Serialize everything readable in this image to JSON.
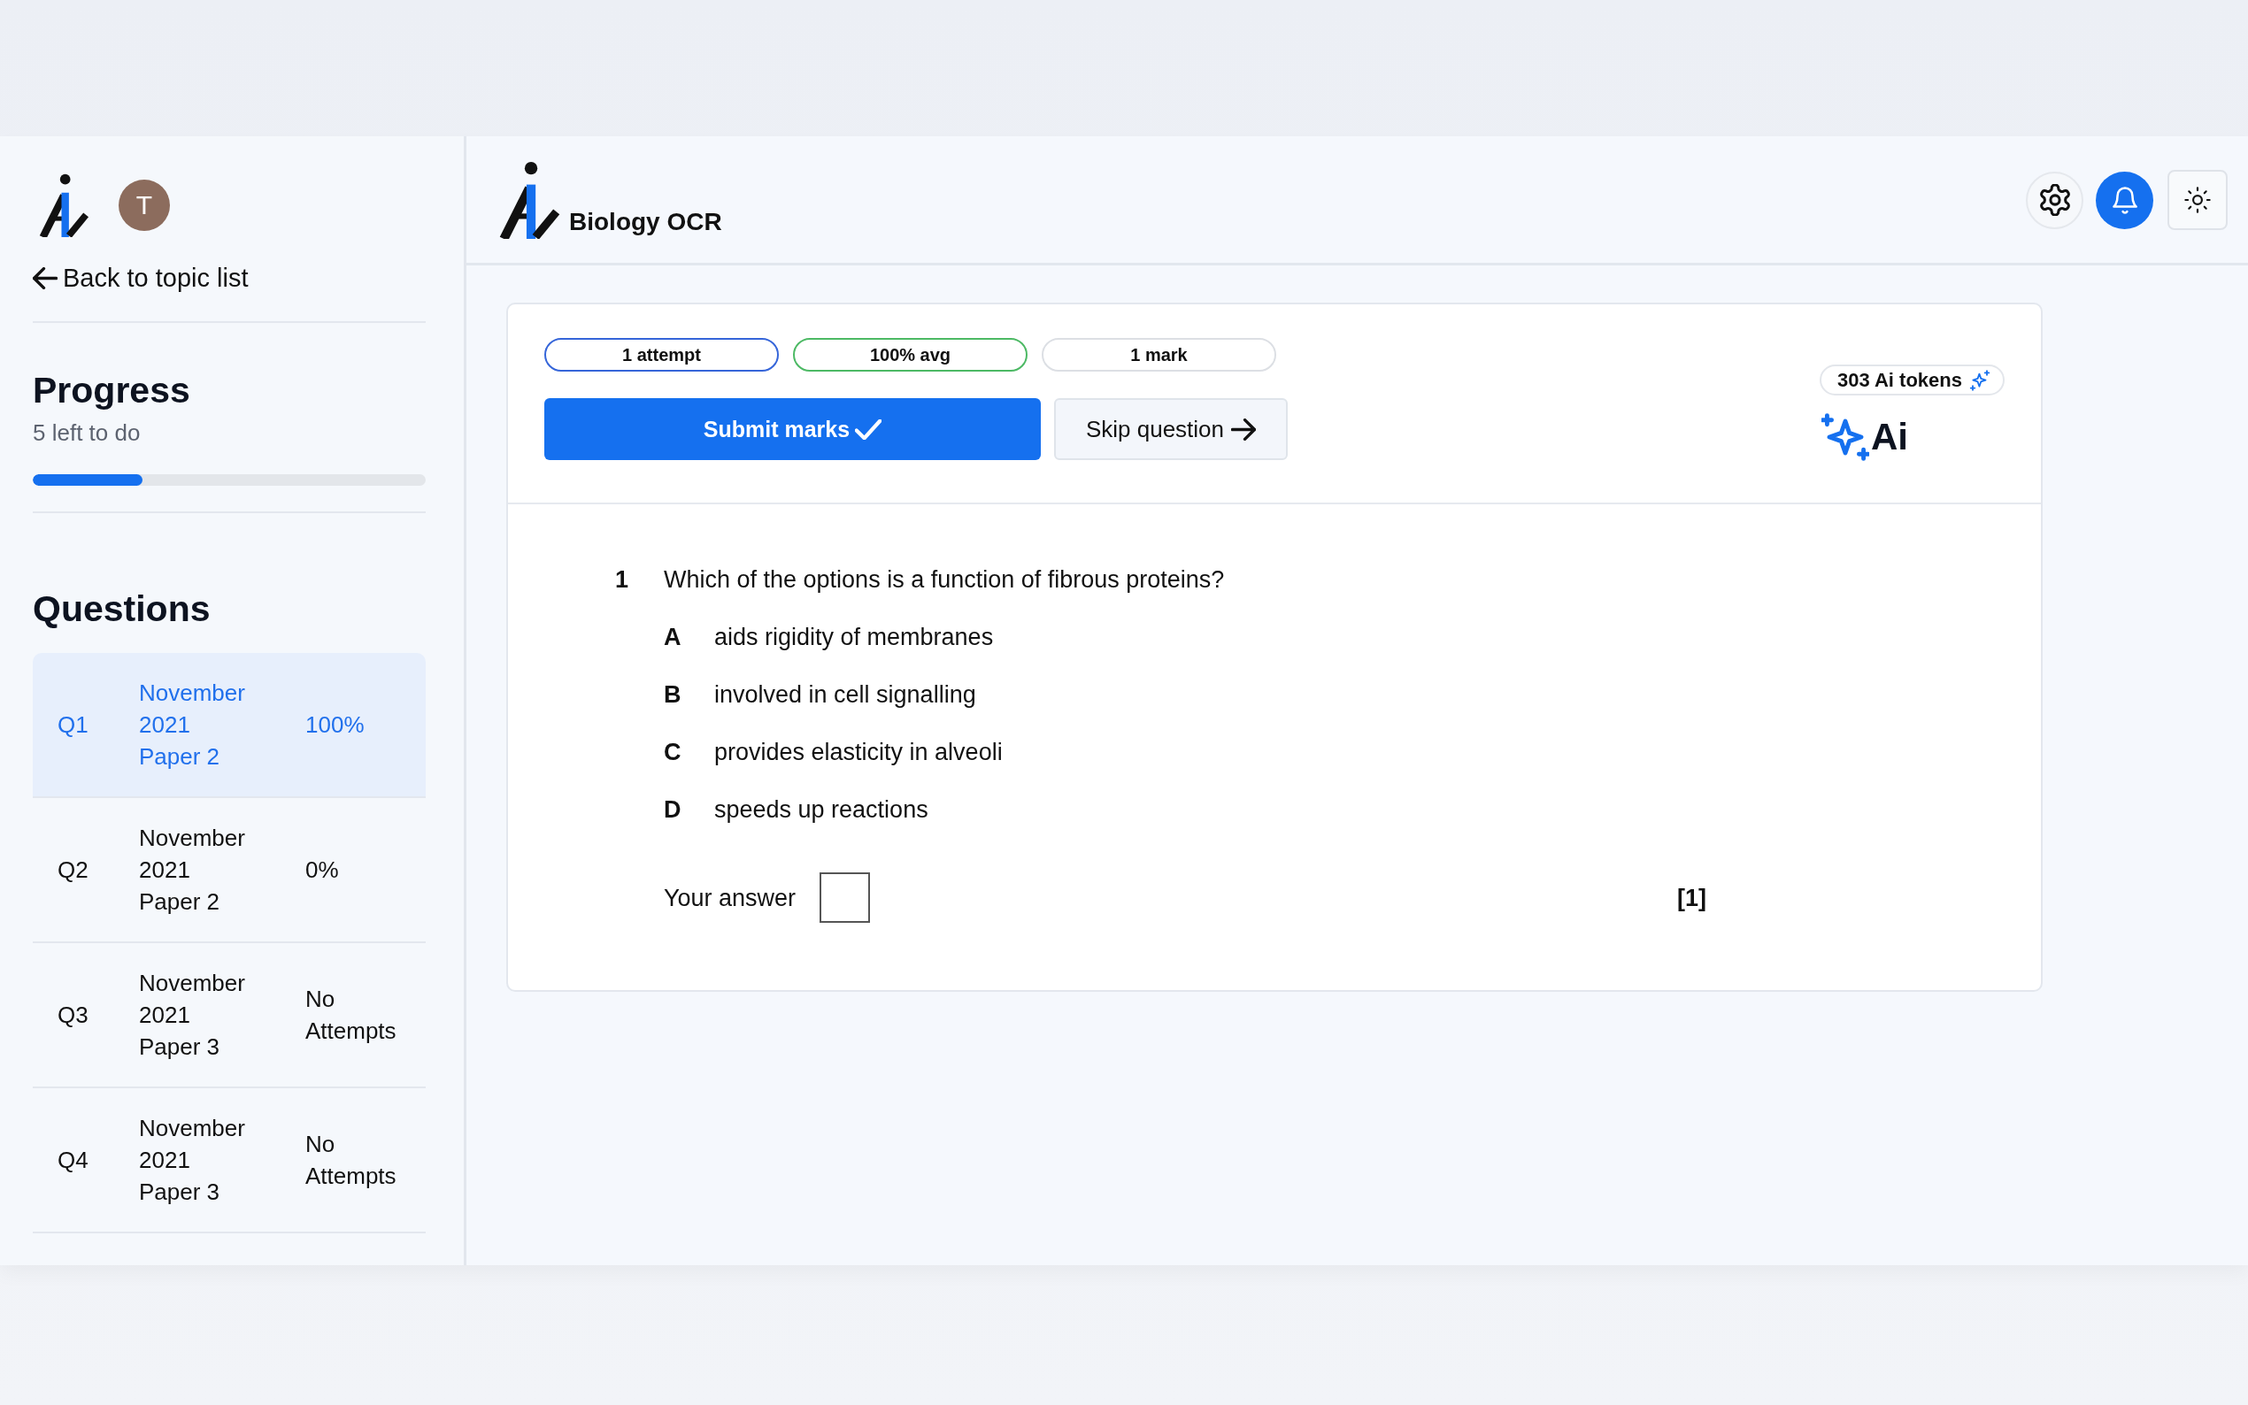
{
  "sidebar": {
    "avatar_initial": "T",
    "back_link": "Back to topic list",
    "progress": {
      "title": "Progress",
      "remaining": "5 left to do",
      "level": 0.28
    },
    "questions_title": "Questions",
    "questions": [
      {
        "label": "Q1",
        "paper": "November 2021 Paper 2",
        "score": "100%",
        "selected": true
      },
      {
        "label": "Q2",
        "paper": "November 2021 Paper 2",
        "score": "0%",
        "selected": false
      },
      {
        "label": "Q3",
        "paper": "November 2021 Paper 3",
        "score": "No Attempts",
        "selected": false
      },
      {
        "label": "Q4",
        "paper": "November 2021 Paper 3",
        "score": "No Attempts",
        "selected": false
      }
    ]
  },
  "header": {
    "title": "Biology OCR"
  },
  "stats": [
    {
      "label": "1 attempt",
      "color": "#3565d9"
    },
    {
      "label": "100% avg",
      "color": "#4cb964"
    },
    {
      "label": "1 mark",
      "color": "#dcdfe4"
    }
  ],
  "actions": {
    "submit": "Submit marks",
    "skip": "Skip question"
  },
  "ai": {
    "tokens": "303 Ai tokens",
    "label": "Ai"
  },
  "question": {
    "number": "1",
    "text": "Which of the options is a function of fibrous proteins?",
    "options": [
      {
        "letter": "A",
        "text": "aids rigidity of membranes"
      },
      {
        "letter": "B",
        "text": "involved in cell signalling"
      },
      {
        "letter": "C",
        "text": "provides elasticity in alveoli"
      },
      {
        "letter": "D",
        "text": "speeds up reactions"
      }
    ],
    "answer_label": "Your answer",
    "marks": "[1]"
  }
}
